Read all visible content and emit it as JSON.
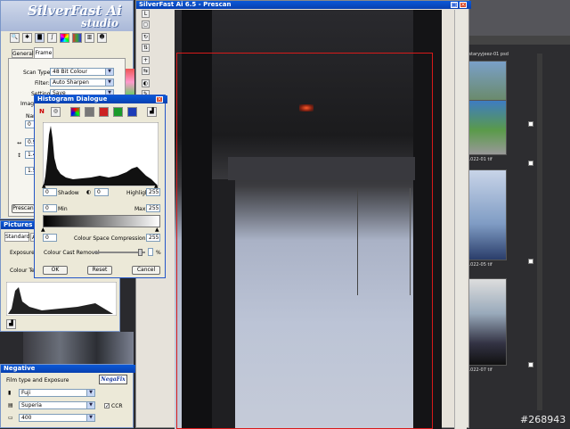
{
  "app": {
    "logo_line1": "SilverFast Ai",
    "logo_line2": "studio",
    "tabs": [
      "General",
      "Frame"
    ],
    "scan_type_label": "Scan Type:",
    "scan_type_value": "48 Bit Colour",
    "filter_label": "Filter:",
    "filter_value": "Auto Sharpen",
    "setting_label": "Setting",
    "setting_value": "Save",
    "image_label": "Image",
    "name_label": "Nam",
    "values_left": [
      "0.9",
      "1.4",
      "1.5"
    ],
    "prescan_label": "Prescan",
    "pictures_title": "Pictures Settin",
    "lower_tabs": [
      "Standard",
      "A"
    ],
    "exposure_label": "Exposure",
    "colour_temp_label": "Colour Temp"
  },
  "histogram": {
    "title": "Histogram Dialogue",
    "shadow_value": "0",
    "shadow_label": "Shadow",
    "midtone_value": "0",
    "highlight_label": "Highlight",
    "highlight_value": "255",
    "min_value": "0",
    "min_label": "Min",
    "max_label": "Max",
    "max_value": "255",
    "compression_low": "0",
    "compression_label": "Colour Space Compression",
    "compression_high": "255",
    "cast_removal_label": "Colour Cast Removal",
    "percent_sign": "%",
    "ok_label": "OK",
    "reset_label": "Reset",
    "cancel_label": "Cancel"
  },
  "negative": {
    "title": "Negative",
    "section_label": "Film type and Exposure",
    "negafix_label": "NegaFix",
    "brand_value": "Fuji",
    "film_value": "Superia",
    "ccr_label": "CCR",
    "iso_value": "400"
  },
  "preview": {
    "title": "SilverFast Ai 6.5 - Prescan"
  },
  "browser": {
    "thumbs": [
      {
        "label": "istaryyjeez-01 psd"
      },
      {
        "label": "1022-01 tif"
      },
      {
        "label": "1022-05 tif"
      },
      {
        "label": "1022-07 tif"
      }
    ]
  },
  "watermark": "#268943"
}
